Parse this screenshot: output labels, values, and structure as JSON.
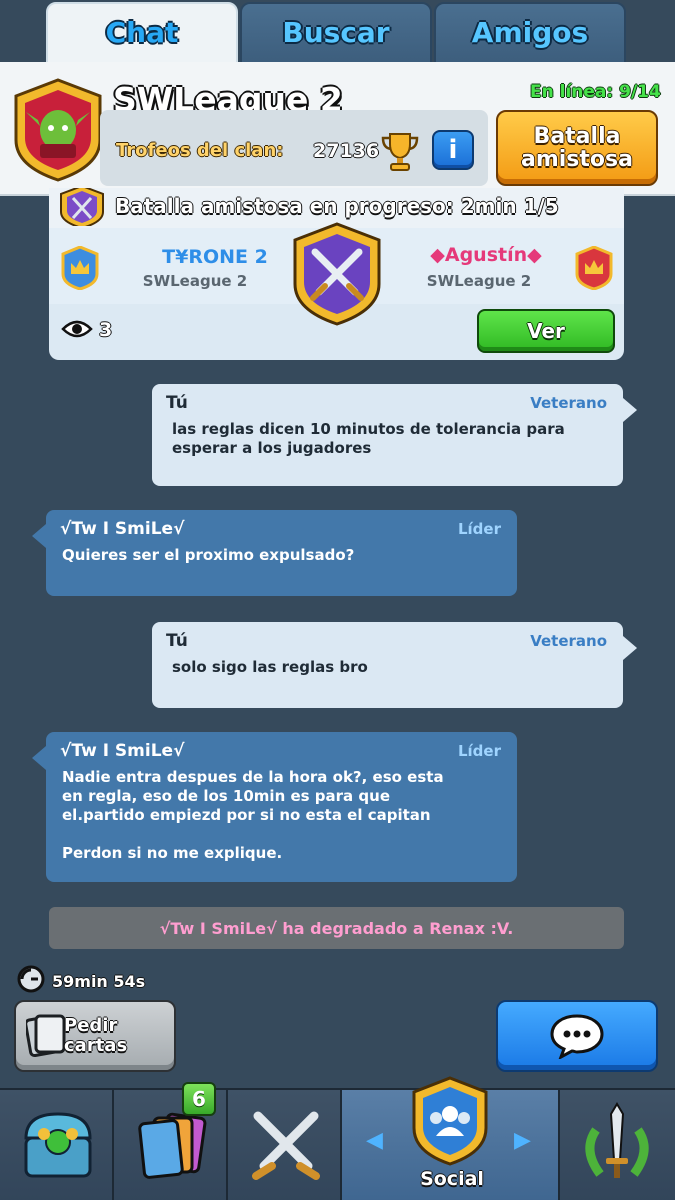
{
  "tabs": [
    {
      "label": "Chat",
      "active": true
    },
    {
      "label": "Buscar",
      "active": false
    },
    {
      "label": "Amigos",
      "active": false
    }
  ],
  "clan": {
    "name": "SWLeague 2",
    "online": "En línea: 9/14",
    "trophies_label": "Trofeos del clan:",
    "trophies_value": "27136",
    "friendly_battle_line1": "Batalla",
    "friendly_battle_line2": "amistosa"
  },
  "battle": {
    "status": "Batalla amistosa en progreso: 2min 1/5",
    "player1": {
      "name": "T¥RONE 2",
      "clan": "SWLeague 2"
    },
    "player2": {
      "name": "◆Agustín◆",
      "clan": "SWLeague 2"
    },
    "spectators": "3",
    "watch_label": "Ver"
  },
  "messages": [
    {
      "sender": "Tú",
      "role": "Veterano",
      "text": "las reglas dicen 10 minutos de tolerancia para\nesperar a los jugadores",
      "mine": true
    },
    {
      "sender": "√Tw I SmiLe√",
      "role": "Líder",
      "text": "Quieres ser el proximo expulsado?",
      "mine": false
    },
    {
      "sender": "Tú",
      "role": "Veterano",
      "text": "solo sigo las reglas bro",
      "mine": true
    },
    {
      "sender": "√Tw I SmiLe√",
      "role": "Líder",
      "text": "Nadie entra despues de la hora ok?, eso esta\nen regla, eso de los 10min es para que\nel.partido empiezd por si no esta el capitan\n\nPerdon si no me explique.",
      "mine": false
    }
  ],
  "system_notice": "√Tw I SmiLe√ ha degradado a Renax :V.",
  "timer": "59min 54s",
  "request_cards_line1": "Pedir",
  "request_cards_line2": "cartas",
  "nav": {
    "cards_badge": "6",
    "social_label": "Social"
  },
  "colors": {
    "background": "#364a5c",
    "accent_blue": "#27a8f5",
    "online_green": "#46e24a",
    "leader_bubble": "#4378aa",
    "own_bubble": "#dbe8f3"
  }
}
